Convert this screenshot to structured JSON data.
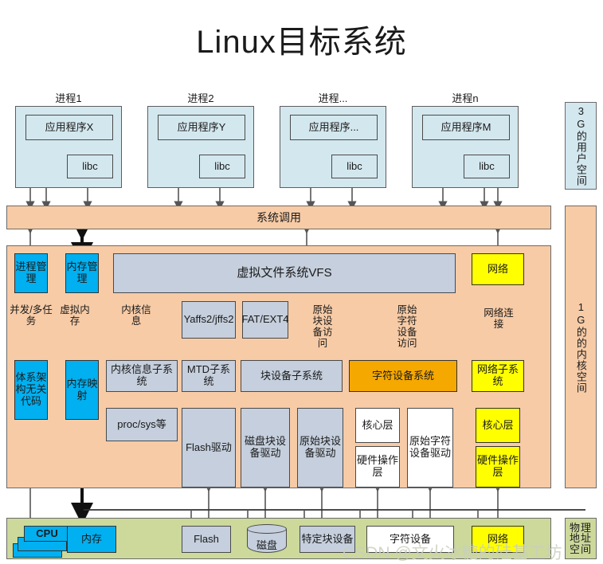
{
  "title": "Linux目标系统",
  "watermark": "CSDN @文火冰糖的硅基工坊",
  "processes": [
    {
      "title": "进程1",
      "app": "应用程序X",
      "lib": "libc"
    },
    {
      "title": "进程2",
      "app": "应用程序Y",
      "lib": "libc"
    },
    {
      "title": "进程...",
      "app": "应用程序...",
      "lib": "libc"
    },
    {
      "title": "进程n",
      "app": "应用程序M",
      "lib": "libc"
    }
  ],
  "syscall": "系统调用",
  "sidebars": {
    "user": "3G的用户空间",
    "kernel": "1G的的内核空间",
    "physical": "物理地址空间"
  },
  "kernel": {
    "row_top": [
      {
        "label": "进程管理",
        "color": "cyan"
      },
      {
        "label": "内存管理",
        "color": "cyan"
      },
      {
        "label": "虚拟文件系统VFS",
        "color": "grayblue"
      },
      {
        "label": "网络",
        "color": "yellow"
      }
    ],
    "connectors": [
      "并发/多任务",
      "虚拟内存",
      "内核信息",
      "原始块设备访问",
      "原始字符设备访问",
      "网络连接"
    ],
    "filesystems": [
      {
        "label": "Yaffs2/jffs2",
        "color": "grayblue"
      },
      {
        "label": "FAT/EXT4",
        "color": "grayblue"
      }
    ],
    "row_mid": [
      {
        "label": "体系架构无关代码",
        "color": "cyan"
      },
      {
        "label": "内存映射",
        "color": "cyan"
      },
      {
        "label": "内核信息子系统",
        "color": "grayblue"
      },
      {
        "label": "MTD子系统",
        "color": "grayblue"
      },
      {
        "label": "块设备子系统",
        "color": "grayblue"
      },
      {
        "label": "字符设备系统",
        "color": "orange"
      },
      {
        "label": "网络子系统",
        "color": "yellow"
      }
    ],
    "row_drivers": [
      {
        "label": "proc/sys等",
        "color": "grayblue"
      },
      {
        "label": "Flash驱动",
        "color": "grayblue"
      },
      {
        "label": "磁盘块设备驱动",
        "color": "grayblue"
      },
      {
        "label": "原始块设备驱动",
        "color": "grayblue"
      },
      {
        "label": "核心层",
        "color": "white"
      },
      {
        "label": "硬件操作层",
        "color": "white"
      },
      {
        "label": "原始字符设备驱动",
        "color": "white"
      },
      {
        "label": "核心层",
        "color": "yellow"
      },
      {
        "label": "硬件操作层",
        "color": "yellow"
      }
    ]
  },
  "hardware": [
    {
      "label": "CPU",
      "color": "cyan"
    },
    {
      "label": "内存",
      "color": "cyan"
    },
    {
      "label": "Flash",
      "color": "grayblue"
    },
    {
      "label": "磁盘",
      "color": "grayblue"
    },
    {
      "label": "特定块设备",
      "color": "grayblue"
    },
    {
      "label": "字符设备",
      "color": "white"
    },
    {
      "label": "网络",
      "color": "yellow"
    }
  ],
  "colors": {
    "cyan": "#00b0f0",
    "yellow": "#ffff00",
    "orange": "#f5a800",
    "grayblue": "#c5cfdd",
    "peach": "#f7cba6",
    "green": "#ccd99b",
    "lightblue": "#d3e7ee"
  }
}
